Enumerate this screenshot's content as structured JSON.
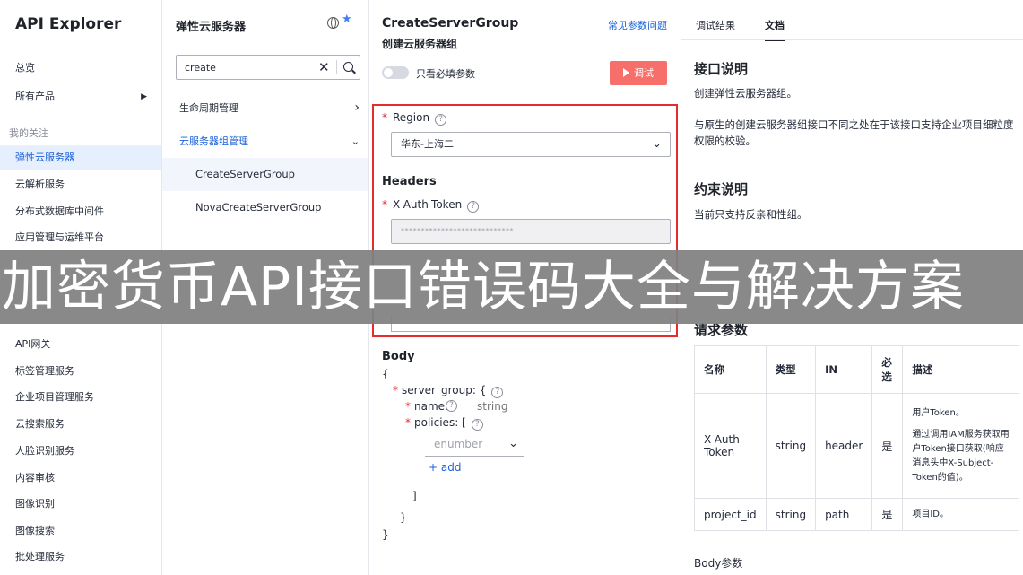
{
  "app": {
    "title": "API Explorer"
  },
  "nav": {
    "overview": "总览",
    "all_products": "所有产品",
    "my_follow_title": "我的关注",
    "items": [
      "弹性云服务器",
      "云解析服务",
      "分布式数据库中间件",
      "应用管理与运维平台"
    ],
    "items_lower": [
      "API网关",
      "标签管理服务",
      "企业项目管理服务",
      "云搜索服务",
      "人脸识别服务",
      "内容审核",
      "图像识别",
      "图像搜索",
      "批处理服务"
    ]
  },
  "service": {
    "title": "弹性云服务器",
    "search_value": "create",
    "tree": {
      "lifecycle": "生命周期管理",
      "server_group_mgmt": "云服务器组管理",
      "leaves": [
        "CreateServerGroup",
        "NovaCreateServerGroup"
      ]
    }
  },
  "form": {
    "api_name": "CreateServerGroup",
    "api_cn_name": "创建云服务器组",
    "faq_link": "常见参数问题",
    "toggle_label": "只看必填参数",
    "debug_button": "调试",
    "region_label": "Region",
    "region_value": "华东-上海二",
    "headers_title": "Headers",
    "token_label": "X-Auth-Token",
    "token_masked": "****************************",
    "body_title": "Body",
    "body": {
      "open_brace": "{",
      "server_group": "server_group: {",
      "name": "name:",
      "name_placeholder": "string",
      "policies": "policies: [",
      "enum_placeholder": "enumber",
      "add": "add",
      "close_bracket": "]",
      "close_inner": "}",
      "close_outer": "}"
    }
  },
  "docs": {
    "tabs": [
      "调试结果",
      "文档"
    ],
    "active_tab": "文档",
    "interface_title": "接口说明",
    "interface_p1": "创建弹性云服务器组。",
    "interface_p2": "与原生的创建云服务器组接口不同之处在于该接口支持企业项目细粒度权限的校验。",
    "constraint_title": "约束说明",
    "constraint_p": "当前只支持反亲和性组。",
    "request_title": "请求参数",
    "table": {
      "headers": [
        "名称",
        "类型",
        "IN",
        "必选",
        "描述"
      ],
      "rows": [
        {
          "name": "X-Auth-Token",
          "type": "string",
          "in": "header",
          "required": "是",
          "desc1": "用户Token。",
          "desc2": "通过调用IAM服务获取用户Token接口获取(响应消息头中X-Subject-Token的值)。"
        },
        {
          "name": "project_id",
          "type": "string",
          "in": "path",
          "required": "是",
          "desc1": "项目ID。",
          "desc2": ""
        }
      ]
    },
    "body_params": "Body参数"
  },
  "banner": {
    "text": "加密货币API接口错误码大全与解决方案"
  },
  "colors": {
    "accent": "#1a60d8",
    "debug_button": "#f66f6a",
    "highlight_box": "#e52c2c"
  }
}
